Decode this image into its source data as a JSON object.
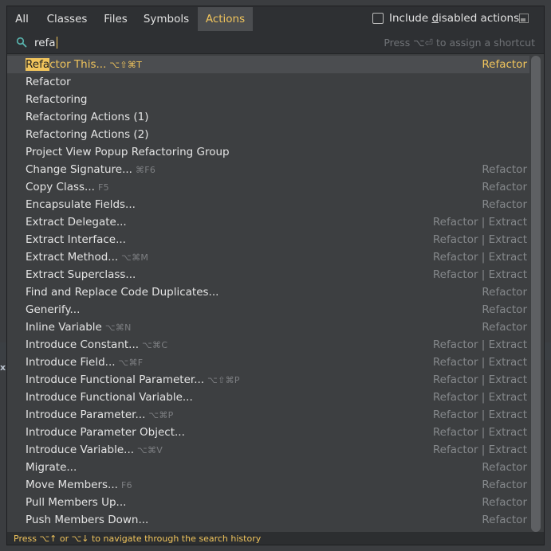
{
  "tabs": [
    "All",
    "Classes",
    "Files",
    "Symbols",
    "Actions"
  ],
  "include_disabled": {
    "before": "Include ",
    "underlined": "d",
    "after": "isabled actions"
  },
  "search": {
    "value": "refa",
    "hint": "Press ⌥⏎ to assign a shortcut"
  },
  "results": [
    {
      "hl": "Refa",
      "rest": "ctor This...",
      "shortcut": "⌥⇧⌘T",
      "group": "Refactor",
      "selected": true
    },
    {
      "hl": "",
      "rest": "Refactor",
      "shortcut": "",
      "group": ""
    },
    {
      "hl": "",
      "rest": "Refactoring",
      "shortcut": "",
      "group": ""
    },
    {
      "hl": "",
      "rest": "Refactoring Actions (1)",
      "shortcut": "",
      "group": ""
    },
    {
      "hl": "",
      "rest": "Refactoring Actions (2)",
      "shortcut": "",
      "group": ""
    },
    {
      "hl": "",
      "rest": "Project View Popup Refactoring Group",
      "shortcut": "",
      "group": ""
    },
    {
      "hl": "",
      "rest": "Change Signature...",
      "shortcut": "⌘F6",
      "group": "Refactor"
    },
    {
      "hl": "",
      "rest": "Copy Class...",
      "shortcut": "F5",
      "group": "Refactor"
    },
    {
      "hl": "",
      "rest": "Encapsulate Fields...",
      "shortcut": "",
      "group": "Refactor"
    },
    {
      "hl": "",
      "rest": "Extract Delegate...",
      "shortcut": "",
      "group": "Refactor | Extract"
    },
    {
      "hl": "",
      "rest": "Extract Interface...",
      "shortcut": "",
      "group": "Refactor | Extract"
    },
    {
      "hl": "",
      "rest": "Extract Method...",
      "shortcut": "⌥⌘M",
      "group": "Refactor | Extract"
    },
    {
      "hl": "",
      "rest": "Extract Superclass...",
      "shortcut": "",
      "group": "Refactor | Extract"
    },
    {
      "hl": "",
      "rest": "Find and Replace Code Duplicates...",
      "shortcut": "",
      "group": "Refactor"
    },
    {
      "hl": "",
      "rest": "Generify...",
      "shortcut": "",
      "group": "Refactor"
    },
    {
      "hl": "",
      "rest": "Inline Variable",
      "shortcut": "⌥⌘N",
      "group": "Refactor"
    },
    {
      "hl": "",
      "rest": "Introduce Constant...",
      "shortcut": "⌥⌘C",
      "group": "Refactor | Extract"
    },
    {
      "hl": "",
      "rest": "Introduce Field...",
      "shortcut": "⌥⌘F",
      "group": "Refactor | Extract"
    },
    {
      "hl": "",
      "rest": "Introduce Functional Parameter...",
      "shortcut": "⌥⇧⌘P",
      "group": "Refactor | Extract"
    },
    {
      "hl": "",
      "rest": "Introduce Functional Variable...",
      "shortcut": "",
      "group": "Refactor | Extract"
    },
    {
      "hl": "",
      "rest": "Introduce Parameter...",
      "shortcut": "⌥⌘P",
      "group": "Refactor | Extract"
    },
    {
      "hl": "",
      "rest": "Introduce Parameter Object...",
      "shortcut": "",
      "group": "Refactor | Extract"
    },
    {
      "hl": "",
      "rest": "Introduce Variable...",
      "shortcut": "⌥⌘V",
      "group": "Refactor | Extract"
    },
    {
      "hl": "",
      "rest": "Migrate...",
      "shortcut": "",
      "group": "Refactor"
    },
    {
      "hl": "",
      "rest": "Move Members...",
      "shortcut": "F6",
      "group": "Refactor"
    },
    {
      "hl": "",
      "rest": "Pull Members Up...",
      "shortcut": "",
      "group": "Refactor"
    },
    {
      "hl": "",
      "rest": "Push Members Down...",
      "shortcut": "",
      "group": "Refactor"
    }
  ],
  "footer": "Press ⌥↑ or ⌥↓ to navigate through the search history",
  "edge_glyph": "x",
  "colors": {
    "accent": "#f0c45c",
    "background": "#3d3f41",
    "header": "#2e3033",
    "selection": "#4b4d50"
  }
}
